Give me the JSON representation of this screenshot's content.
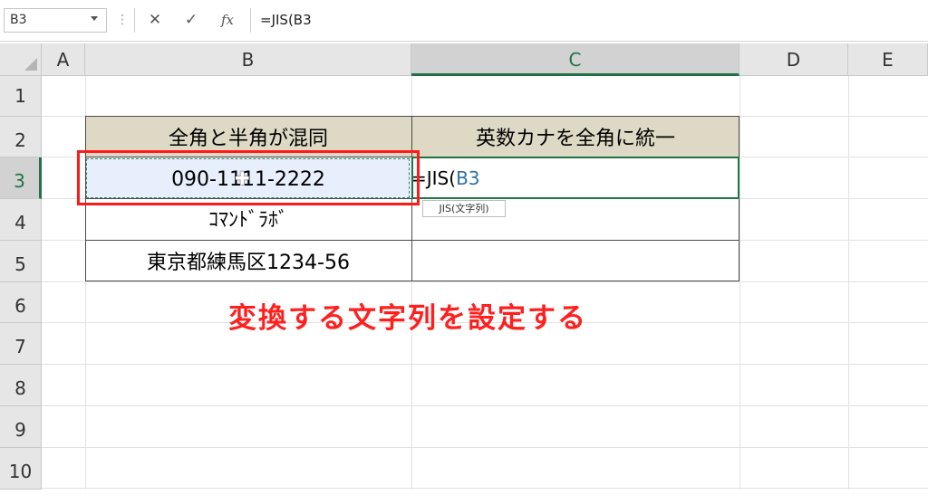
{
  "formula_bar": {
    "name_box": "B3",
    "dots": "⋮",
    "cancel_icon": "✕",
    "enter_icon": "✓",
    "fx_label": "fx",
    "formula": "=JIS(B3"
  },
  "columns": [
    "A",
    "B",
    "C",
    "D",
    "E"
  ],
  "rows": [
    "1",
    "2",
    "3",
    "4",
    "5",
    "6",
    "7",
    "8",
    "9",
    "10"
  ],
  "table": {
    "header_b": "全角と半角が混同",
    "header_c": "英数カナを全角に統一",
    "b3": "090-1111-2222",
    "b4": "ｺﾏﾝﾄﾞﾗﾎﾞ",
    "b5": "東京都練馬区1234-56"
  },
  "editing": {
    "prefix": "=JIS(",
    "ref": "B3",
    "tooltip": "JIS(文字列)"
  },
  "annotation": "変換する文字列を設定する",
  "colors": {
    "header_fill": "#ddd9c4",
    "selection_green": "#217346",
    "annotation_red": "#ff1f1f",
    "ref_blue": "#2f6fa5"
  }
}
